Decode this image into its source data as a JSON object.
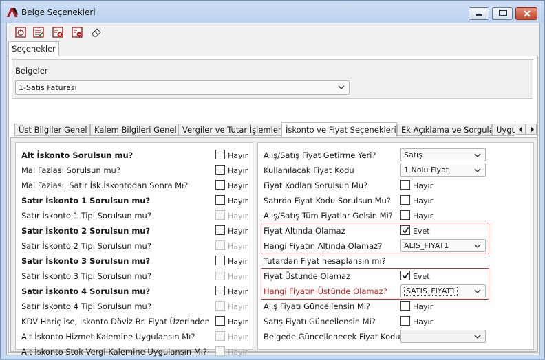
{
  "window": {
    "title": "Belge Seçenekleri",
    "controls": {
      "minimize": "minimize-icon",
      "maximize": "maximize-icon",
      "close": "close-icon"
    }
  },
  "toolbar": {
    "buttons": [
      "power-icon",
      "checklist-icon",
      "add-document-icon",
      "remove-document-icon",
      "eraser-icon"
    ]
  },
  "top_tab": "Seçenekler",
  "belgeler": {
    "label": "Belgeler",
    "selected": "1-Satış Faturası"
  },
  "tabs": [
    {
      "label": "Üst Bilgiler Genel",
      "active": false
    },
    {
      "label": "Kalem Bilgileri Genel",
      "active": false
    },
    {
      "label": "Vergiler ve Tutar İşlemleri",
      "active": false
    },
    {
      "label": "İskonto ve Fiyat Seçenekleri",
      "active": true
    },
    {
      "label": "Ek Açıklama ve Sorgular",
      "active": false
    },
    {
      "label": "Uygu",
      "active": false
    }
  ],
  "left_options": [
    {
      "label": "Alt İskonto Sorulsun mu?",
      "bold": true,
      "checkbox": "Hayır",
      "checked": false,
      "disabled": false
    },
    {
      "label": "Mal Fazlası Sorulsun mu?",
      "bold": false,
      "checkbox": "Hayır",
      "checked": false,
      "disabled": false
    },
    {
      "label": "Mal Fazlası, Satır İsk.İskontodan Sonra Mı?",
      "bold": false,
      "checkbox": "Hayır",
      "checked": false,
      "disabled": false
    },
    {
      "label": "Satır İskonto 1 Sorulsun mu?",
      "bold": true,
      "checkbox": "Hayır",
      "checked": false,
      "disabled": false
    },
    {
      "label": "Satır İskonto 1 Tipi Sorulsun mu?",
      "bold": false,
      "checkbox": "Hayır",
      "checked": false,
      "disabled": true
    },
    {
      "label": "Satır İskonto 2 Sorulsun mu?",
      "bold": true,
      "checkbox": "Hayır",
      "checked": false,
      "disabled": false
    },
    {
      "label": "Satır İskonto 2 Tipi Sorulsun mu?",
      "bold": false,
      "checkbox": "Hayır",
      "checked": false,
      "disabled": true
    },
    {
      "label": "Satır İskonto 3 Sorulsun mu?",
      "bold": true,
      "checkbox": "Hayır",
      "checked": false,
      "disabled": false
    },
    {
      "label": "Satır İskonto 3 Tipi Sorulsun mu?",
      "bold": false,
      "checkbox": "Hayır",
      "checked": false,
      "disabled": true
    },
    {
      "label": "Satır İskonto 4 Sorulsun mu?",
      "bold": true,
      "checkbox": "Hayır",
      "checked": false,
      "disabled": false
    },
    {
      "label": "Satır İskonto 4 Tipi Sorulsun mu?",
      "bold": false,
      "checkbox": "Hayır",
      "checked": false,
      "disabled": true
    },
    {
      "label": "KDV Hariç ise, İskonto Döviz Br. Fiyat Üzerinden",
      "bold": false,
      "checkbox": "Hayır",
      "checked": false,
      "disabled": false
    },
    {
      "label": "Alt İskonto Hizmet Kalemine Uygulansın Mı?",
      "bold": false,
      "checkbox": "Hayır",
      "checked": false,
      "disabled": true
    },
    {
      "label": "Alt İskonto Stok Vergi Kalemine Uygulansın Mı?",
      "bold": false,
      "checkbox": "Hayır",
      "checked": false,
      "disabled": true
    }
  ],
  "right_options": [
    {
      "label": "Alış/Satış Fiyat Getirme Yeri?",
      "control": "select",
      "value": "Satış"
    },
    {
      "label": "Kullanılacak Fiyat Kodu",
      "control": "select",
      "value": "1 Nolu Fiyat"
    },
    {
      "label": "Fiyat Kodları Sorulsun Mu?",
      "control": "checkbox",
      "checked": false,
      "value": "Hayır"
    },
    {
      "label": "Satırda Fiyat Kodu Sorulsun Mu?",
      "control": "checkbox",
      "checked": false,
      "value": "Hayır"
    },
    {
      "label": "Alış/Satış Tüm Fiyatlar Gelsin Mi?",
      "control": "checkbox",
      "checked": false,
      "value": "Hayır"
    },
    {
      "label": "Fiyat Altında Olamaz",
      "control": "checkbox",
      "checked": true,
      "value": "Evet"
    },
    {
      "label": "Hangi Fiyatın Altında Olamaz?",
      "control": "select",
      "value": "ALIS_FIYAT1"
    },
    {
      "label": "Tutardan Fiyat hesaplansın mı?",
      "control": "none",
      "value": ""
    },
    {
      "label": "Fiyat Üstünde Olamaz",
      "control": "checkbox",
      "checked": true,
      "value": "Evet"
    },
    {
      "label": "Hangi Fiyatın Üstünde Olamaz?",
      "control": "select",
      "value": "SATIS_FIYAT1",
      "red": true,
      "focused": true
    },
    {
      "label": "Alış Fiyatı Güncellensin Mi?",
      "control": "checkbox",
      "checked": false,
      "value": "Hayır"
    },
    {
      "label": "Satış Fiyatı Güncellensin Mi?",
      "control": "checkbox",
      "checked": false,
      "value": "Hayır"
    },
    {
      "label": "Belgede Güncellenecek Fiyat Kodu",
      "control": "select",
      "value": "",
      "disabled": true
    }
  ],
  "colors": {
    "highlight_border": "#d32a2a",
    "red_label": "#d01c1c",
    "window_frame": "#c9daf0"
  }
}
